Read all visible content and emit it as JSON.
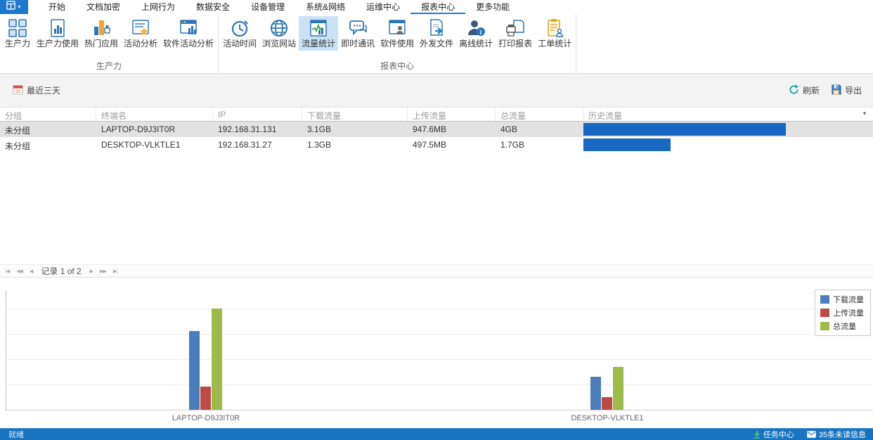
{
  "menubar": {
    "selected_index": 7,
    "tabs": [
      {
        "label": "开始"
      },
      {
        "label": "文档加密"
      },
      {
        "label": "上网行为"
      },
      {
        "label": "数据安全"
      },
      {
        "label": "设备管理"
      },
      {
        "label": "系统&网络"
      },
      {
        "label": "运维中心"
      },
      {
        "label": "报表中心"
      },
      {
        "label": "更多功能"
      }
    ]
  },
  "ribbon": {
    "groups": [
      {
        "label": "生产力",
        "buttons": [
          {
            "label": "生产力",
            "icon": "grid-icon",
            "selected": false
          },
          {
            "label": "生产力使用",
            "icon": "doc-bars-icon",
            "selected": false
          },
          {
            "label": "热门应用",
            "icon": "hot-apps-icon",
            "selected": false
          },
          {
            "label": "活动分析",
            "icon": "doc-star-icon",
            "selected": false
          },
          {
            "label": "软件活动分析",
            "icon": "window-bars-icon",
            "selected": false
          }
        ]
      },
      {
        "label": "报表中心",
        "buttons": [
          {
            "label": "活动时间",
            "icon": "clock-icon",
            "selected": false
          },
          {
            "label": "浏览网站",
            "icon": "globe-icon",
            "selected": false
          },
          {
            "label": "流量统计",
            "icon": "traffic-chart-icon",
            "selected": true
          },
          {
            "label": "即时通讯",
            "icon": "chat-icon",
            "selected": false
          },
          {
            "label": "软件使用",
            "icon": "window-user-icon",
            "selected": false
          },
          {
            "label": "外发文件",
            "icon": "doc-arrow-icon",
            "selected": false
          },
          {
            "label": "离线统计",
            "icon": "user-info-icon",
            "selected": false
          },
          {
            "label": "打印报表",
            "icon": "printer-icon",
            "selected": false
          },
          {
            "label": "工单统计",
            "icon": "clipboard-user-icon",
            "selected": false
          }
        ]
      }
    ]
  },
  "toolbar": {
    "date_filter": "最近三天",
    "date_filter_icon": "calendar-icon",
    "refresh_label": "刷新",
    "refresh_icon": "refresh-icon",
    "export_label": "导出",
    "export_icon": "export-disk-icon"
  },
  "table": {
    "columns": [
      "分组",
      "终端名",
      "IP",
      "下载流量",
      "上传流量",
      "总流量",
      "历史流量"
    ],
    "rows": [
      {
        "group": "未分组",
        "terminal": "LAPTOP-D9J3IT0R",
        "ip": "192.168.31.131",
        "download": "3.1GB",
        "upload": "947.6MB",
        "total": "4GB",
        "history_ratio": 0.7,
        "selected": true
      },
      {
        "group": "未分组",
        "terminal": "DESKTOP-VLKTLE1",
        "ip": "192.168.31.27",
        "download": "1.3GB",
        "upload": "497.5MB",
        "total": "1.7GB",
        "history_ratio": 0.3,
        "selected": false
      }
    ]
  },
  "pagination": {
    "label": "记录 1 of 2",
    "left_buttons": [
      {
        "name": "first-page",
        "glyph": "|◀"
      },
      {
        "name": "fast-prev-page",
        "glyph": "◀◀"
      },
      {
        "name": "prev-page",
        "glyph": "◀"
      }
    ],
    "right_buttons": [
      {
        "name": "next-page",
        "glyph": "▶"
      },
      {
        "name": "fast-next-page",
        "glyph": "▶▶"
      },
      {
        "name": "last-page",
        "glyph": "▶|"
      }
    ]
  },
  "chart_data": {
    "type": "bar",
    "categories": [
      "LAPTOP-D9J3IT0R",
      "DESKTOP-VLKTLE1"
    ],
    "series": [
      {
        "name": "下载流量",
        "color": "#4a7ebb",
        "values_gb": [
          3.1,
          0.93
        ]
      },
      {
        "name": "上传流量",
        "color": "#bd4b45",
        "values_gb": [
          1.3,
          0.49
        ]
      },
      {
        "name": "总流量",
        "color": "#9dbb49",
        "values_gb": [
          4.0,
          1.7
        ]
      }
    ],
    "series_note": "values_gb arrays are [LAPTOP-D9J3IT0R, DESKTOP-VLKTLE1]; rendered per category as download/upload/total triplets",
    "per_category_values_gb": [
      [
        3.1,
        0.93,
        4.0
      ],
      [
        1.3,
        0.49,
        1.7
      ]
    ],
    "ylim": [
      0,
      4.75
    ],
    "gridline_step_gb": 1,
    "y_tick_labels_visible": false,
    "legend_position": "top-right",
    "xlabel": "",
    "ylabel": "",
    "title": ""
  },
  "statusbar": {
    "ready": "就绪",
    "task_center": "任务中心",
    "unread": "35条未读信息"
  },
  "colors": {
    "accent_blue": "#1f78cc",
    "ribbon_selected_bg": "#c9e2f6",
    "history_bar": "#1668c2",
    "status_bar": "#1874c0",
    "bar_download": "#4a7ebb",
    "bar_upload": "#bd4b45",
    "bar_total": "#9dbb49"
  }
}
